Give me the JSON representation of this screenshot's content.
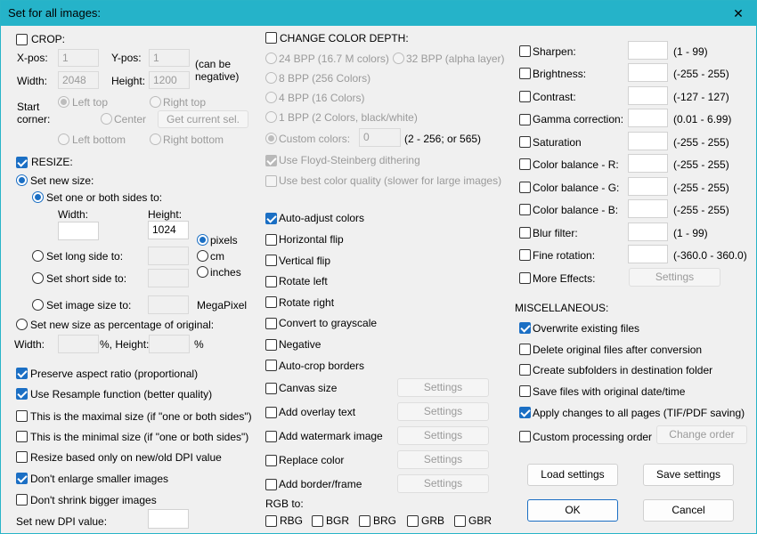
{
  "window": {
    "title": "Set for all images:"
  },
  "crop": {
    "label": "CROP:",
    "xpos_label": "X-pos:",
    "xpos": "1",
    "ypos_label": "Y-pos:",
    "ypos": "1",
    "width_label": "Width:",
    "width": "2048",
    "height_label": "Height:",
    "height": "1200",
    "can_be": "(can be",
    "negative": "negative)",
    "start": "Start",
    "corner": "corner:",
    "left_top": "Left top",
    "right_top": "Right top",
    "center": "Center",
    "get_current": "Get current sel.",
    "left_bottom": "Left bottom",
    "right_bottom": "Right bottom"
  },
  "resize": {
    "label": "RESIZE:",
    "set_new_size": "Set new size:",
    "one_or_both": "Set one or both sides to:",
    "width_label": "Width:",
    "height_label": "Height:",
    "width": "",
    "height": "1024",
    "pixels": "pixels",
    "cm": "cm",
    "inches": "inches",
    "long_side": "Set long side to:",
    "short_side": "Set short side to:",
    "image_size": "Set image size to:",
    "megapixel": "MegaPixel",
    "percentage": "Set new size as percentage of original:",
    "pct_width": "Width:",
    "pct_height": "%, Height:",
    "pct_sign": "%",
    "preserve": "Preserve aspect ratio (proportional)",
    "resample": "Use Resample function (better quality)",
    "maximal": "This is the maximal size (if \"one or both sides\")",
    "minimal": "This is the minimal size (if \"one or both sides\")",
    "dpi_based": "Resize based only on new/old DPI value",
    "dont_enlarge": "Don't enlarge smaller images",
    "dont_shrink": "Don't shrink bigger images",
    "new_dpi": "Set new DPI value:"
  },
  "color_depth": {
    "label": "CHANGE COLOR DEPTH:",
    "bpp24": "24 BPP (16.7 M colors)",
    "bpp32": "32 BPP (alpha layer)",
    "bpp8": "8 BPP (256 Colors)",
    "bpp4": "4 BPP (16 Colors)",
    "bpp1": "1 BPP (2 Colors, black/white)",
    "custom": "Custom colors:",
    "custom_value": "0",
    "custom_range": "(2 - 256; or 565)",
    "floyd": "Use Floyd-Steinberg dithering",
    "best": "Use best color quality (slower for large images)"
  },
  "mid": {
    "auto_adjust": "Auto-adjust colors",
    "hflip": "Horizontal flip",
    "vflip": "Vertical flip",
    "rotate_left": "Rotate left",
    "rotate_right": "Rotate right",
    "grayscale": "Convert to grayscale",
    "negative": "Negative",
    "autocrop": "Auto-crop borders",
    "canvas": "Canvas size",
    "overlay": "Add overlay text",
    "watermark": "Add watermark image",
    "replace": "Replace color",
    "border": "Add border/frame",
    "settings": "Settings",
    "rgb_to": "RGB to:",
    "rbg": "RBG",
    "bgr": "BGR",
    "brg": "BRG",
    "grb": "GRB",
    "gbr": "GBR"
  },
  "effects": {
    "sharpen": "Sharpen:",
    "sharpen_range": "(1  -  99)",
    "brightness": "Brightness:",
    "brightness_range": "(-255  -  255)",
    "contrast": "Contrast:",
    "contrast_range": "(-127  -  127)",
    "gamma": "Gamma correction:",
    "gamma_range": "(0.01  -  6.99)",
    "saturation": "Saturation",
    "saturation_range": "(-255  -  255)",
    "cb_r": "Color balance - R:",
    "cb_r_range": "(-255  -  255)",
    "cb_g": "Color balance - G:",
    "cb_g_range": "(-255  -  255)",
    "cb_b": "Color balance - B:",
    "cb_b_range": "(-255  -  255)",
    "blur": "Blur filter:",
    "blur_range": "(1  -  99)",
    "fine_rotation": "Fine rotation:",
    "fine_rotation_range": "(-360.0  -  360.0)",
    "more": "More Effects:",
    "settings": "Settings"
  },
  "misc": {
    "label": "MISCELLANEOUS:",
    "overwrite": "Overwrite existing files",
    "delete": "Delete original files after conversion",
    "subfolders": "Create subfolders in destination folder",
    "date": "Save files with original date/time",
    "apply_pages": "Apply changes to all pages (TIF/PDF saving)",
    "custom_order": "Custom processing order",
    "change_order": "Change order"
  },
  "buttons": {
    "load": "Load settings",
    "save": "Save settings",
    "ok": "OK",
    "cancel": "Cancel"
  },
  "colors": {
    "titlebar": "#25b3c9",
    "accent": "#1b6fc4"
  }
}
